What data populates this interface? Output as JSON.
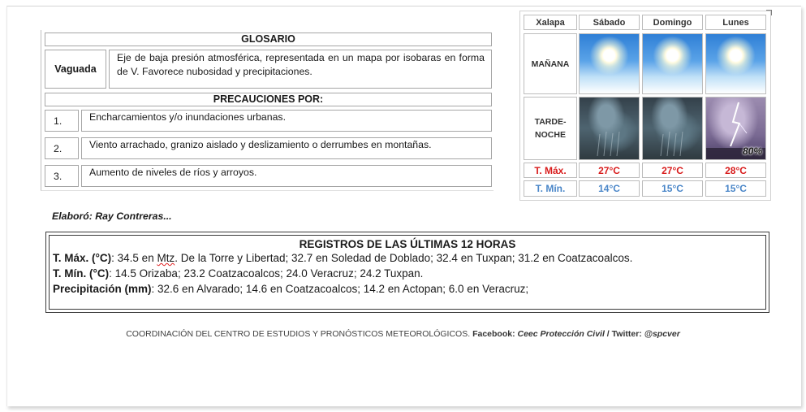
{
  "glossary": {
    "title": "GLOSARIO",
    "term": "Vaguada",
    "definition": "Eje de baja presión atmosférica, representada en un mapa por isobaras en forma de V. Favorece nubosidad y precipitaciones.",
    "precautions_title": "PRECAUCIONES POR:",
    "precautions": [
      {
        "num": "1.",
        "text": "Encharcamientos y/o inundaciones urbanas."
      },
      {
        "num": "2.",
        "text": "Viento arrachado, granizo aislado y deslizamiento o derrumbes en montañas."
      },
      {
        "num": "3.",
        "text": "Aumento de niveles de ríos y arroyos."
      }
    ]
  },
  "forecast": {
    "headers": [
      "Xalapa",
      "Sábado",
      "Domingo",
      "Lunes"
    ],
    "rows": {
      "morning_label": "MAÑANA",
      "afternoon_label": "TARDE-NOCHE",
      "tmax_label": "T. Máx.",
      "tmin_label": "T. Mín."
    },
    "morning_icons": [
      "sunny-icon",
      "sunny-icon",
      "sunny-icon"
    ],
    "afternoon_icons": [
      "storm-icon",
      "storm-icon",
      "thunderstorm-icon"
    ],
    "rain_probability": "80%",
    "tmax": [
      "27°C",
      "27°C",
      "28°C"
    ],
    "tmin": [
      "14°C",
      "15°C",
      "15°C"
    ],
    "colors": {
      "tmax": "#d81b1b",
      "tmin": "#4a86c8"
    }
  },
  "author": "Elaboró: Ray Contreras...",
  "records": {
    "title": "REGISTROS DE LAS ÚLTIMAS 12 HORAS",
    "tmax_label": "T. Máx. (°C)",
    "tmax_pre": ":  34.5 en ",
    "tmax_mtz": "Mtz",
    "tmax_post": ". De la Torre y Libertad; 32.7 en Soledad de Doblado; 32.4 en Tuxpan; 31.2 en Coatzacoalcos.",
    "tmin_label": "T. Mín. (°C)",
    "tmin_text": ": 14.5 Orizaba; 23.2 Coatzacoalcos; 24.0 Veracruz; 24.2 Tuxpan.",
    "precip_label": "Precipitación (mm)",
    "precip_text": ": 32.6 en Alvarado; 14.6 en Coatzacoalcos; 14.2 en Actopan; 6.0 en Veracruz;"
  },
  "footer": {
    "prefix": "COORDINACIÓN DEL CENTRO DE ESTUDIOS Y PRONÓSTICOS METEOROLÓGICOS. ",
    "facebook_label": "Facebook: ",
    "facebook_value": "Ceec Protección Civil",
    "separator": " / ",
    "twitter_label": "Twitter: ",
    "twitter_value": "@spcver"
  }
}
